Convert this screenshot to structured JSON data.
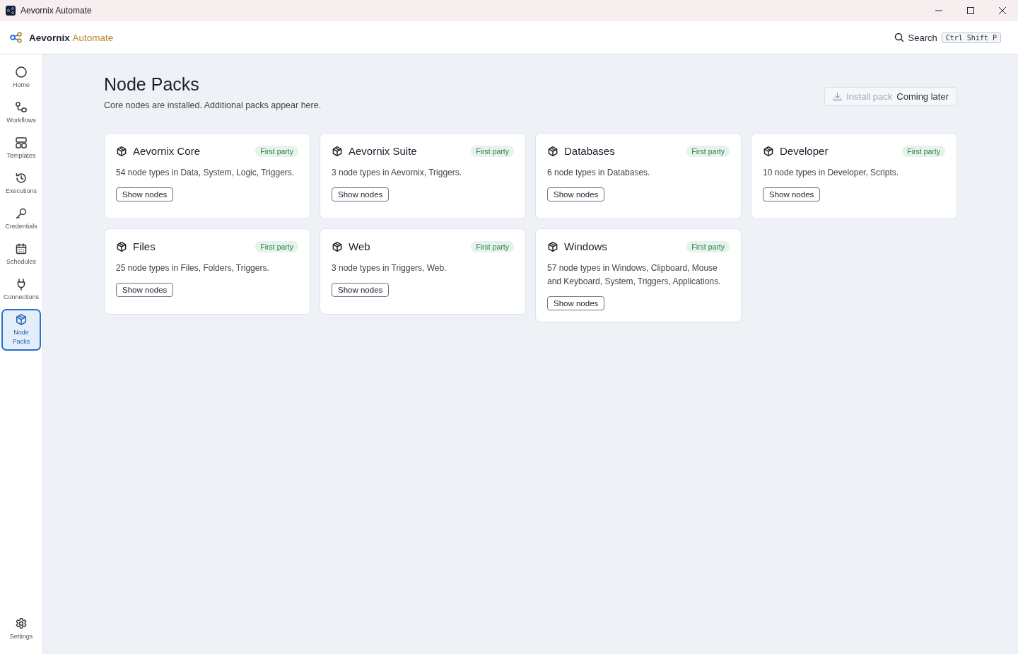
{
  "window": {
    "title": "Aevornix Automate"
  },
  "header": {
    "brand": "Aevornix",
    "brand_accent": "Automate",
    "search_label": "Search",
    "shortcut": "Ctrl Shift P"
  },
  "sidebar": {
    "items": [
      {
        "label": "Home",
        "selected": false
      },
      {
        "label": "Workflows",
        "selected": false
      },
      {
        "label": "Templates",
        "selected": false
      },
      {
        "label": "Executions",
        "selected": false
      },
      {
        "label": "Credentials",
        "selected": false
      },
      {
        "label": "Schedules",
        "selected": false
      },
      {
        "label": "Connections",
        "selected": false
      },
      {
        "label": "Node Packs",
        "selected": true
      }
    ],
    "settings": {
      "label": "Settings",
      "selected": false
    }
  },
  "page": {
    "title": "Node Packs",
    "subtitle": "Core nodes are installed. Additional packs appear here.",
    "install_button": {
      "label": "Install pack",
      "disabled": true
    },
    "install_note": "Coming later"
  },
  "packs": [
    {
      "name": "Aevornix Core",
      "badge": "First party",
      "description": "54 node types in Data, System, Logic, Triggers.",
      "button": "Show nodes"
    },
    {
      "name": "Aevornix Suite",
      "badge": "First party",
      "description": "3 node types in Aevornix, Triggers.",
      "button": "Show nodes"
    },
    {
      "name": "Databases",
      "badge": "First party",
      "description": "6 node types in Databases.",
      "button": "Show nodes"
    },
    {
      "name": "Developer",
      "badge": "First party",
      "description": "10 node types in Developer, Scripts.",
      "button": "Show nodes"
    },
    {
      "name": "Files",
      "badge": "First party",
      "description": "25 node types in Files, Folders, Triggers.",
      "button": "Show nodes"
    },
    {
      "name": "Web",
      "badge": "First party",
      "description": "3 node types in Triggers, Web.",
      "button": "Show nodes"
    },
    {
      "name": "Windows",
      "badge": "First party",
      "description": "57 node types in Windows, Clipboard, Mouse and Keyboard, System, Triggers, Applications.",
      "button": "Show nodes"
    }
  ]
}
